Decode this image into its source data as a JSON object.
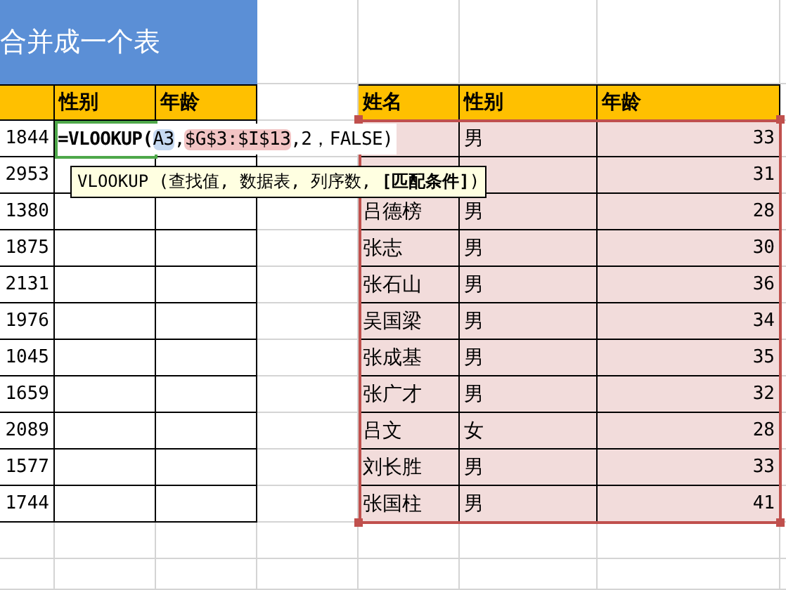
{
  "title": "合并成一个表",
  "left_table": {
    "columns": [
      "性别",
      "年龄"
    ],
    "rows": [
      {
        "column_1": "1844"
      },
      {
        "column_1": "2953"
      },
      {
        "column_1": "1380"
      },
      {
        "column_1": "1875"
      },
      {
        "column_1": "2131"
      },
      {
        "column_1": "1976"
      },
      {
        "column_1": "1045"
      },
      {
        "column_1": "1659"
      },
      {
        "column_1": "2089"
      },
      {
        "column_1": "1577"
      },
      {
        "column_1": "1744"
      }
    ]
  },
  "formula": {
    "function": "=VLOOKUP(",
    "lookup_ref": "A3",
    "separator": ",",
    "range_ref": "$G$3:$I$13",
    "rest": ",2，FALSE)"
  },
  "tooltip": "VLOOKUP (查找值, 数据表, 列序数, **[匹配条件]**)",
  "right_table": {
    "columns": [
      "姓名",
      "性别",
      "年龄"
    ],
    "rows": [
      {
        "gender": "男",
        "age": "33"
      },
      {
        "age": "31"
      },
      {
        "name": "吕德榜",
        "gender": "男",
        "age": "28"
      },
      {
        "name": "张志",
        "gender": "男",
        "age": "30"
      },
      {
        "name": "张石山",
        "gender": "男",
        "age": "36"
      },
      {
        "name": "吴国梁",
        "gender": "男",
        "age": "34"
      },
      {
        "name": "张成基",
        "gender": "男",
        "age": "35"
      },
      {
        "name": "张广才",
        "gender": "男",
        "age": "32"
      },
      {
        "name": "吕文",
        "gender": "女",
        "age": "28"
      },
      {
        "name": "刘长胜",
        "gender": "男",
        "age": "33"
      },
      {
        "name": "张国柱",
        "gender": "男",
        "age": "41"
      }
    ]
  }
}
